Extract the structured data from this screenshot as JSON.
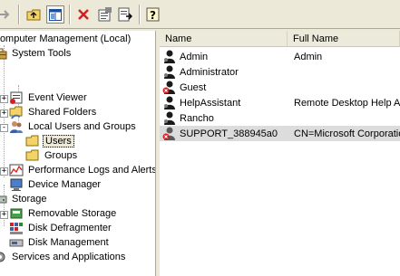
{
  "tree": {
    "root": "Computer Management (Local)",
    "system_tools": "System Tools",
    "event_viewer": "Event Viewer",
    "shared_folders": "Shared Folders",
    "local_users_groups": "Local Users and Groups",
    "users": "Users",
    "groups": "Groups",
    "perf_logs": "Performance Logs and Alerts",
    "device_manager": "Device Manager",
    "storage": "Storage",
    "removable_storage": "Removable Storage",
    "disk_defrag": "Disk Defragmenter",
    "disk_mgmt": "Disk Management",
    "services_apps": "Services and Applications"
  },
  "list": {
    "col_name": "Name",
    "col_fullname": "Full Name",
    "rows": [
      {
        "name": "Admin",
        "full": "Admin"
      },
      {
        "name": "Administrator",
        "full": ""
      },
      {
        "name": "Guest",
        "full": ""
      },
      {
        "name": "HelpAssistant",
        "full": "Remote Desktop Help Assistant Account"
      },
      {
        "name": "Rancho",
        "full": ""
      },
      {
        "name": "SUPPORT_388945a0",
        "full": "CN=Microsoft Corporation,L=Redmond,S=Washington,C=US"
      }
    ]
  },
  "colors": {
    "window_bg": "#ece9d8",
    "selection_gray": "#dcdcdc",
    "delete_red": "#d42020",
    "folder_yellow": "#f3d46b"
  }
}
